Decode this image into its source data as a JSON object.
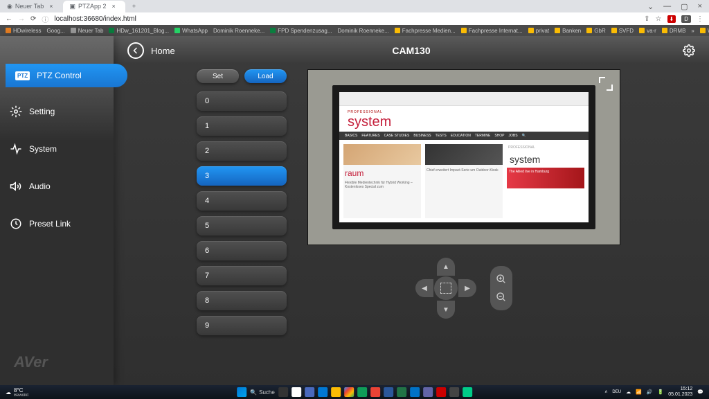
{
  "browser": {
    "tabs": [
      {
        "title": "Neuer Tab",
        "active": false
      },
      {
        "title": "PTZApp 2",
        "active": true
      }
    ],
    "url": "localhost:36680/index.html",
    "bookmarks": [
      "HDwireless",
      "Goog...",
      "Neuer Tab",
      "HDw_161201_Blog...",
      "WhatsApp",
      "Dominik Roenneke...",
      "FPD Spendenzusag...",
      "Dominik Roenneke...",
      "Fachpresse Medien...",
      "Fachpresse Internat...",
      "privat",
      "Banken",
      "GbR",
      "SVFD",
      "va-r",
      "DRMB"
    ],
    "more_bookmarks": "Weitere Lesezeichen"
  },
  "app": {
    "home": "Home",
    "camera": "CAM130",
    "nav": {
      "ptz": "PTZ Control",
      "setting": "Setting",
      "system": "System",
      "audio": "Audio",
      "preset_link": "Preset Link"
    },
    "logo": "AVer",
    "preset_actions": {
      "set": "Set",
      "load": "Load"
    },
    "presets": [
      "0",
      "1",
      "2",
      "3",
      "4",
      "5",
      "6",
      "7",
      "8",
      "9"
    ],
    "active_preset": "3",
    "screen": {
      "prof": "PROFESSIONAL",
      "sys": "system",
      "nav": [
        "BASICS",
        "FEATURES",
        "CASE STUDIES",
        "BUSINESS",
        "TESTS",
        "EDUCATION",
        "TERMINE",
        "SHOP",
        "JOBS",
        "🔍"
      ],
      "col1_hl": "raum",
      "col1_txt": "Flexible Medientechnik für Hybrid Working – Kostenloses Special zum",
      "col2_txt": "Chief erweitert Impact-Serie um Outdoor-Kiosk",
      "col3_sys": "system",
      "col3_ad": "The Allied live in Hamburg"
    }
  },
  "taskbar": {
    "temp": "8°C",
    "weather": "Bewölkt",
    "search": "Suche",
    "time": "15:12",
    "date": "05.01.2023"
  }
}
